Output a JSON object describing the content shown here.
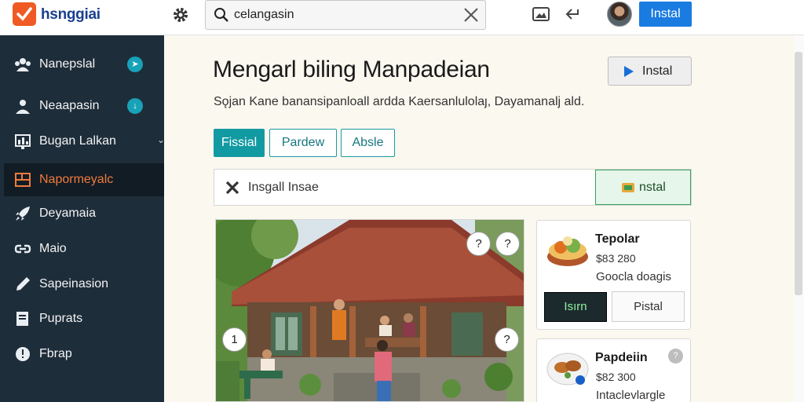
{
  "app": {
    "logo_text": "hsnggiai",
    "brand_color": "#f05a24"
  },
  "topbar": {
    "search_value": "celangasin",
    "install_label": "Instal"
  },
  "sidebar": {
    "items": [
      {
        "label": "Nanepslal",
        "icon": "group-icon",
        "badge": "➤"
      },
      {
        "label": "Neaapasin",
        "icon": "user-icon",
        "badge": "↓"
      },
      {
        "label": "Bugan Lalkan",
        "icon": "chart-icon",
        "chevron": "⌄"
      },
      {
        "label": "Napormeyalc",
        "icon": "layout-icon",
        "active": true
      },
      {
        "label": "Deyamaia",
        "icon": "rocket-icon"
      },
      {
        "label": "Maio",
        "icon": "link-icon"
      },
      {
        "label": "Sapeinasion",
        "icon": "pen-icon"
      },
      {
        "label": "Puprats",
        "icon": "document-icon"
      },
      {
        "label": "Fbrap",
        "icon": "info-icon"
      }
    ]
  },
  "main": {
    "title": "Mengarl biling Manpadeian",
    "subtitle": "Sǫjan Kane banansipanloall ardda Kaersanlulolaȷ, Dayamanalj ald.",
    "install_label": "Instal",
    "tabs": [
      {
        "label": "Fissial",
        "active": true
      },
      {
        "label": "Pardew",
        "active": false
      },
      {
        "label": "Absle",
        "active": false
      }
    ],
    "install_row": {
      "text": "Insgall Insae",
      "button_label": "nstal"
    },
    "hero_badges": [
      "?",
      "?",
      "1",
      "?"
    ]
  },
  "cards": [
    {
      "name": "Tepolar",
      "price": "$83  280",
      "desc": "Goocla doagis",
      "btn_primary": "Isırn",
      "btn_secondary": "Pistal",
      "thumb": "food-bowl-icon"
    },
    {
      "name": "Papdeiin",
      "price": "$82  300",
      "desc": "Intaclevlargle",
      "help": "?",
      "thumb": "food-plate-icon"
    }
  ]
}
